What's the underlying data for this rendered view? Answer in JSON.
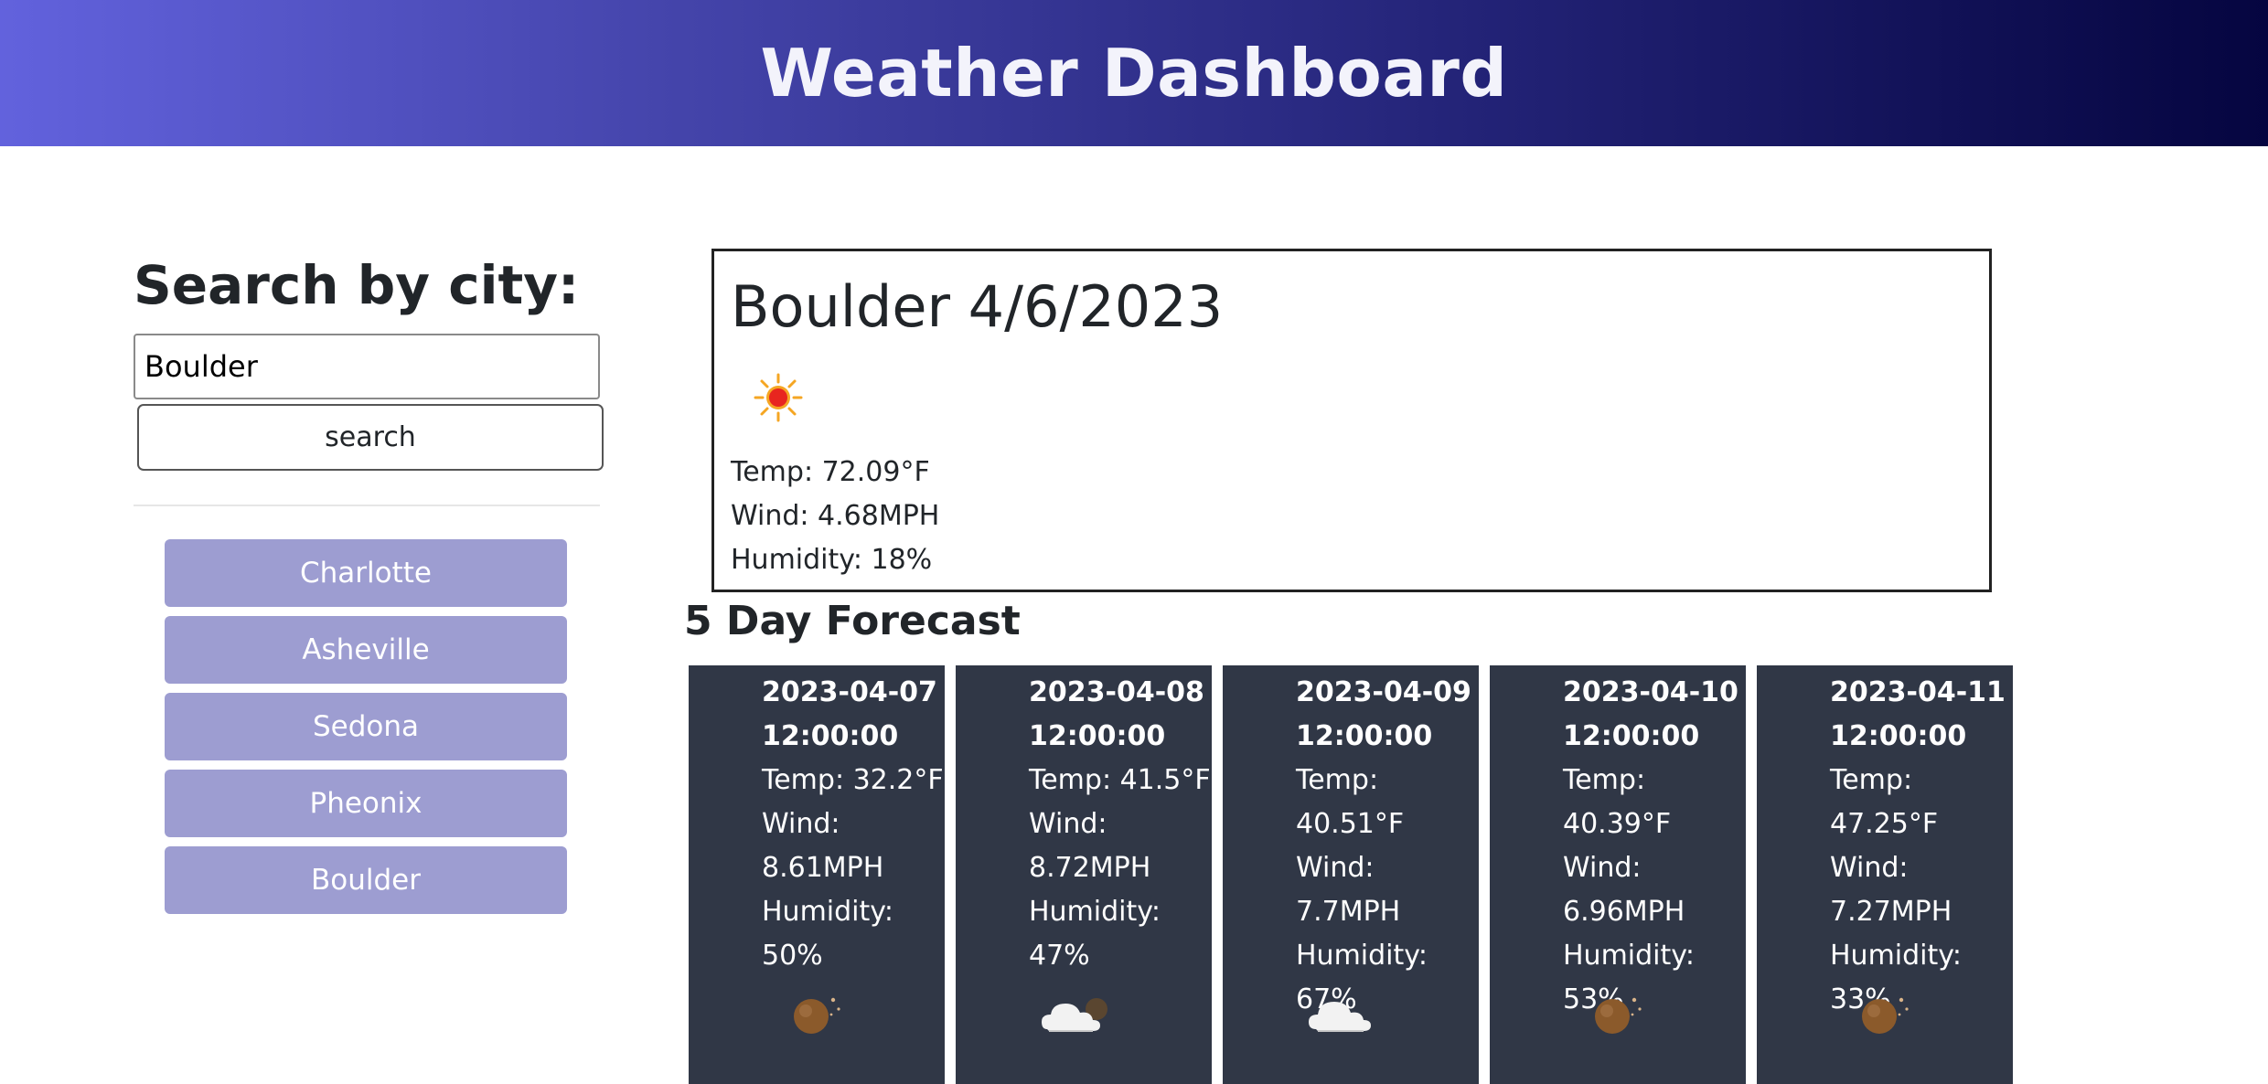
{
  "header": {
    "title": "Weather Dashboard"
  },
  "search": {
    "title": "Search by city:",
    "input_value": "Boulder",
    "button_label": "search"
  },
  "history": [
    {
      "label": "Charlotte"
    },
    {
      "label": "Asheville"
    },
    {
      "label": "Sedona"
    },
    {
      "label": "Pheonix"
    },
    {
      "label": "Boulder"
    }
  ],
  "current": {
    "title": "Boulder 4/6/2023",
    "icon": "sunny-icon",
    "temp": "Temp: 72.09°F",
    "wind": "Wind: 4.68MPH",
    "humidity": "Humidity: 18%"
  },
  "forecast": {
    "title": "5 Day Forecast",
    "days": [
      {
        "date": "2023-04-07",
        "time": "12:00:00",
        "temp": "Temp: 32.2°F",
        "wind_label": "Wind:",
        "wind": "8.61MPH",
        "humidity_label": "Humidity:",
        "humidity": "50%",
        "icon": "night-clear-icon"
      },
      {
        "date": "2023-04-08",
        "time": "12:00:00",
        "temp": "Temp: 41.5°F",
        "wind_label": "Wind:",
        "wind": "8.72MPH",
        "humidity_label": "Humidity:",
        "humidity": "47%",
        "icon": "night-cloudy-icon"
      },
      {
        "date": "2023-04-09",
        "time": "12:00:00",
        "temp": "Temp: 40.51°F",
        "wind_label": "Wind:",
        "wind": "7.7MPH",
        "humidity_label": "Humidity:",
        "humidity": "67%",
        "icon": "cloud-icon"
      },
      {
        "date": "2023-04-10",
        "time": "12:00:00",
        "temp": "Temp: 40.39°F",
        "wind_label": "Wind:",
        "wind": "6.96MPH",
        "humidity_label": "Humidity:",
        "humidity": "53%",
        "icon": "night-clear-icon"
      },
      {
        "date": "2023-04-11",
        "time": "12:00:00",
        "temp": "Temp: 47.25°F",
        "wind_label": "Wind:",
        "wind": "7.27MPH",
        "humidity_label": "Humidity:",
        "humidity": "33%",
        "icon": "night-clear-icon"
      }
    ]
  },
  "colors": {
    "header_gradient_start": "#6262dd",
    "header_gradient_end": "#050540",
    "history_button_bg": "#9d9dd1",
    "forecast_card_bg": "#303746"
  }
}
